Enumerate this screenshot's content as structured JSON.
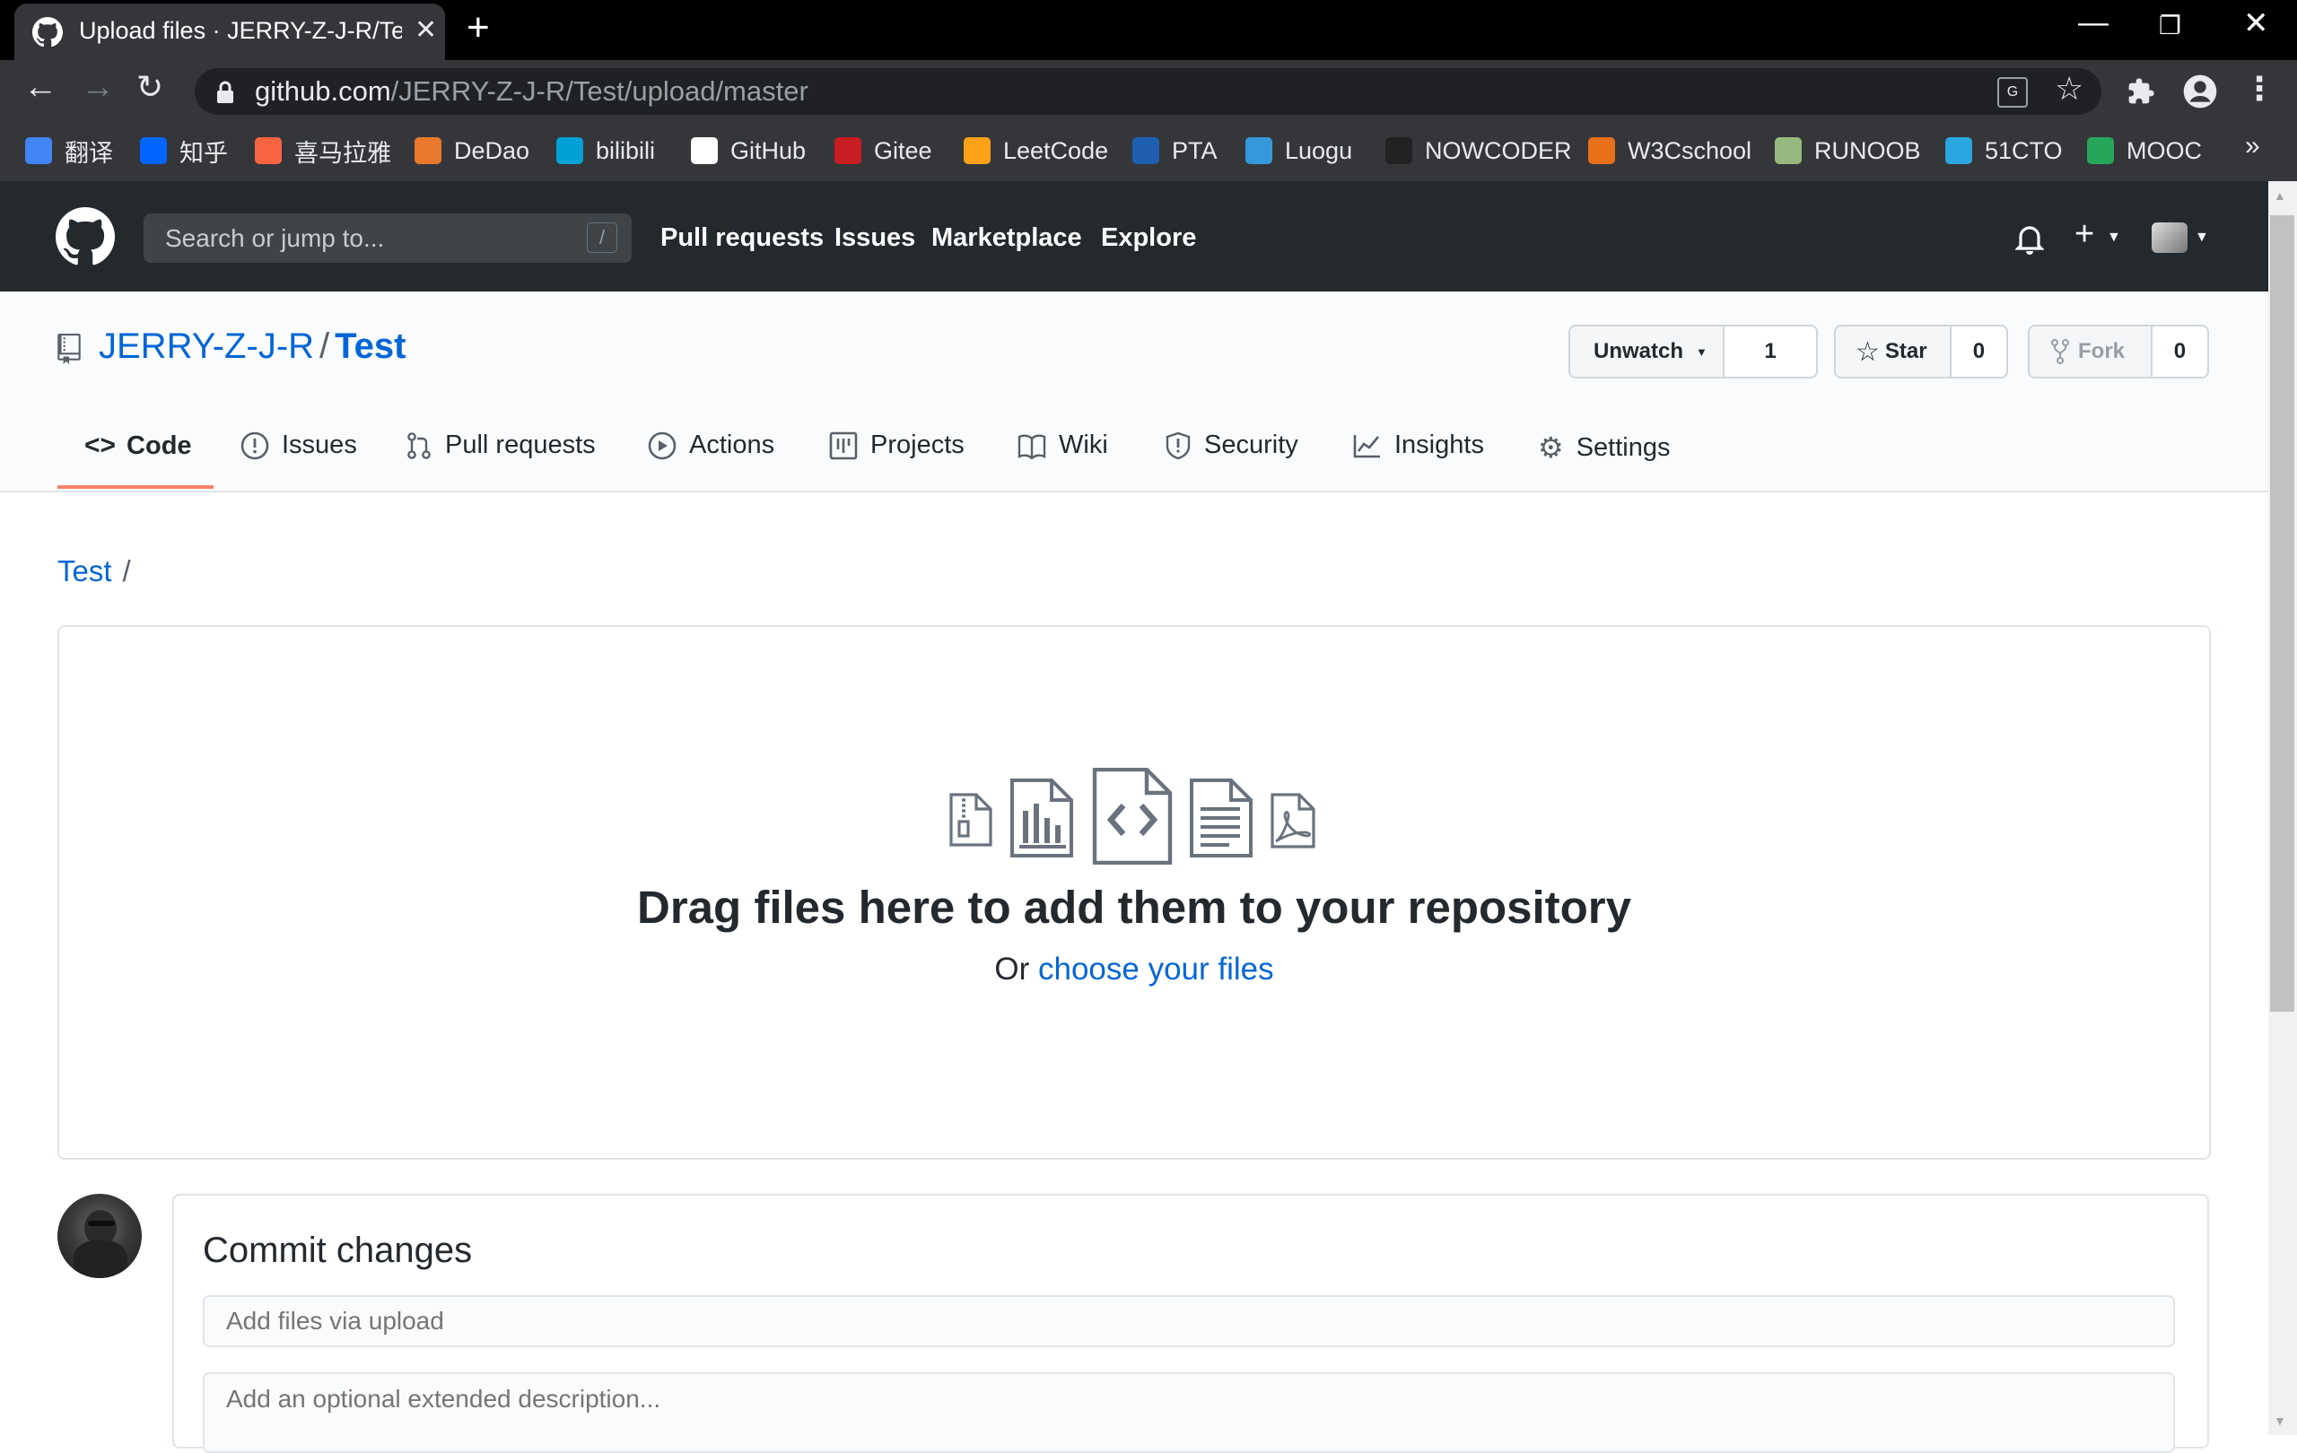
{
  "browser": {
    "tab_title": "Upload files · JERRY-Z-J-R/Test",
    "url_host": "github.com",
    "url_path": "/JERRY-Z-J-R/Test/upload/master",
    "bookmarks": [
      {
        "label": "翻译",
        "icon": "google-translate-icon",
        "color": "#4285f4"
      },
      {
        "label": "知乎",
        "icon": "zhihu-icon",
        "color": "#0066ff"
      },
      {
        "label": "喜马拉雅",
        "icon": "ximalaya-icon",
        "color": "#f86442"
      },
      {
        "label": "DeDao",
        "icon": "dedao-icon",
        "color": "#e8792c"
      },
      {
        "label": "bilibili",
        "icon": "bilibili-icon",
        "color": "#00a1d6"
      },
      {
        "label": "GitHub",
        "icon": "github-icon",
        "color": "#ffffff"
      },
      {
        "label": "Gitee",
        "icon": "gitee-icon",
        "color": "#c71d23"
      },
      {
        "label": "LeetCode",
        "icon": "leetcode-icon",
        "color": "#ffa116"
      },
      {
        "label": "PTA",
        "icon": "pta-icon",
        "color": "#1f5fb0"
      },
      {
        "label": "Luogu",
        "icon": "luogu-icon",
        "color": "#3498db"
      },
      {
        "label": "NOWCODER",
        "icon": "nowcoder-icon",
        "color": "#222222"
      },
      {
        "label": "W3Cschool",
        "icon": "w3cschool-icon",
        "color": "#e8701a"
      },
      {
        "label": "RUNOOB",
        "icon": "runoob-icon",
        "color": "#96b97d"
      },
      {
        "label": "51CTO",
        "icon": "51cto-icon",
        "color": "#2aa6e0"
      },
      {
        "label": "MOOC",
        "icon": "mooc-icon",
        "color": "#26a65b"
      }
    ]
  },
  "header": {
    "search_placeholder": "Search or jump to...",
    "search_shortcut": "/",
    "nav": [
      "Pull requests",
      "Issues",
      "Marketplace",
      "Explore"
    ]
  },
  "repo": {
    "owner": "JERRY-Z-J-R",
    "separator": "/",
    "name": "Test",
    "watch_label": "Unwatch",
    "watch_count": "1",
    "star_label": "Star",
    "star_count": "0",
    "fork_label": "Fork",
    "fork_count": "0",
    "tabs": [
      "Code",
      "Issues",
      "Pull requests",
      "Actions",
      "Projects",
      "Wiki",
      "Security",
      "Insights",
      "Settings"
    ],
    "active_tab": "Code"
  },
  "breadcrumb": {
    "root": "Test",
    "sep": "/"
  },
  "upload": {
    "title": "Drag files here to add them to your repository",
    "or_text": "Or",
    "choose_link": "choose your files"
  },
  "commit": {
    "title": "Commit changes",
    "summary_placeholder": "Add files via upload",
    "description_placeholder": "Add an optional extended description..."
  },
  "colors": {
    "accent_link": "#0366d6",
    "header_bg": "#24292e",
    "active_tab": "#f9826c"
  }
}
